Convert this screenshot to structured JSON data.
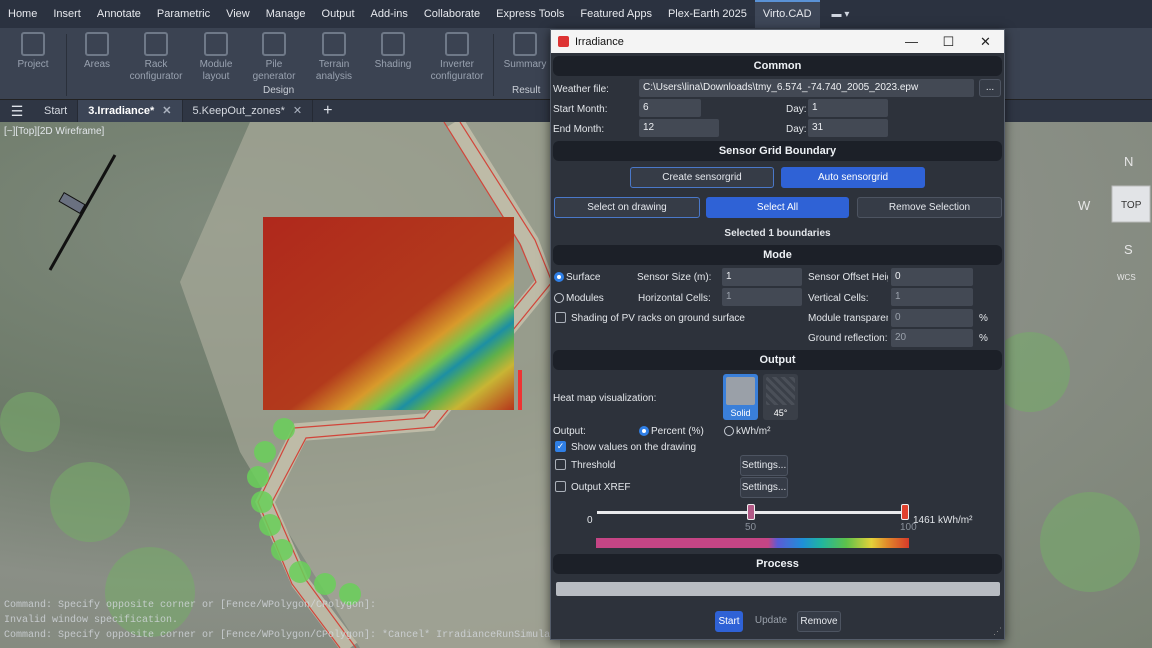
{
  "menubar": {
    "items": [
      "Home",
      "Insert",
      "Annotate",
      "Parametric",
      "View",
      "Manage",
      "Output",
      "Add-ins",
      "Collaborate",
      "Express Tools",
      "Featured Apps",
      "Plex-Earth 2025",
      "Virto.CAD"
    ],
    "active_index": 12
  },
  "ribbon": {
    "tools": [
      "Project",
      "Areas",
      "Rack configurator",
      "Module layout",
      "Pile generator",
      "Terrain analysis",
      "Shading",
      "Inverter configurator",
      "Summary"
    ],
    "groups": {
      "design": "Design",
      "result": "Result"
    }
  },
  "tabs": {
    "items": [
      "Start",
      "3.Irradiance*",
      "5.KeepOut_zones*"
    ],
    "active_index": 1
  },
  "drawing": {
    "view_label": "[−][Top][2D Wireframe]",
    "compass": {
      "n": "N",
      "w": "W",
      "s": "S",
      "top": "TOP",
      "wcs": "WCS"
    },
    "cmd1": "Command: Specify opposite corner or [Fence/WPolygon/CPolygon]:",
    "cmd2": "Invalid window specification.",
    "cmd3": "Command: Specify opposite corner or [Fence/WPolygon/CPolygon]: *Cancel* IrradianceRunSimulation"
  },
  "dialog": {
    "title": "Irradiance",
    "controls": {
      "minimize": "—",
      "maximize": "☐",
      "close": "✕"
    },
    "common": {
      "header": "Common",
      "weather_label": "Weather file:",
      "weather_value": "C:\\Users\\lina\\Downloads\\tmy_6.574_-74.740_2005_2023.epw",
      "browse": "...",
      "start_month_label": "Start Month:",
      "start_month": "6",
      "start_day_label": "Day:",
      "start_day": "1",
      "end_month_label": "End Month:",
      "end_month": "12",
      "end_day_label": "Day:",
      "end_day": "31"
    },
    "grid": {
      "header": "Sensor Grid Boundary",
      "create": "Create sensorgrid",
      "auto": "Auto sensorgrid",
      "select_drawing": "Select on drawing",
      "select_all": "Select All",
      "remove": "Remove Selection",
      "status": "Selected 1 boundaries"
    },
    "mode": {
      "header": "Mode",
      "surface": "Surface",
      "modules": "Modules",
      "sensor_size_label": "Sensor Size (m):",
      "sensor_size": "1",
      "offset_label": "Sensor Offset Heigh",
      "offset": "0",
      "hcells_label": "Horizontal Cells:",
      "hcells": "1",
      "vcells_label": "Vertical Cells:",
      "vcells": "1",
      "shading_label": "Shading of PV racks on ground surface",
      "transparency_label": "Module transparenc",
      "transparency": "0",
      "reflection_label": "Ground reflection:",
      "reflection": "20",
      "pct": "%"
    },
    "output": {
      "header": "Output",
      "heatmap_label": "Heat map visualization:",
      "solid": "Solid",
      "hatch": "45°",
      "output_label": "Output:",
      "percent": "Percent (%)",
      "kwh": "kWh/m²",
      "show_values": "Show values on the drawing",
      "threshold": "Threshold",
      "xref": "Output XREF",
      "settings": "Settings...",
      "slider_min": "0",
      "slider_mid": "50",
      "slider_max": "100",
      "slider_value_text": "1461 kWh/m²",
      "slider_low_fraction": 0.5,
      "slider_high_fraction": 1.0
    },
    "process": {
      "header": "Process",
      "progress": 0,
      "start": "Start",
      "update": "Update",
      "remove": "Remove"
    }
  }
}
